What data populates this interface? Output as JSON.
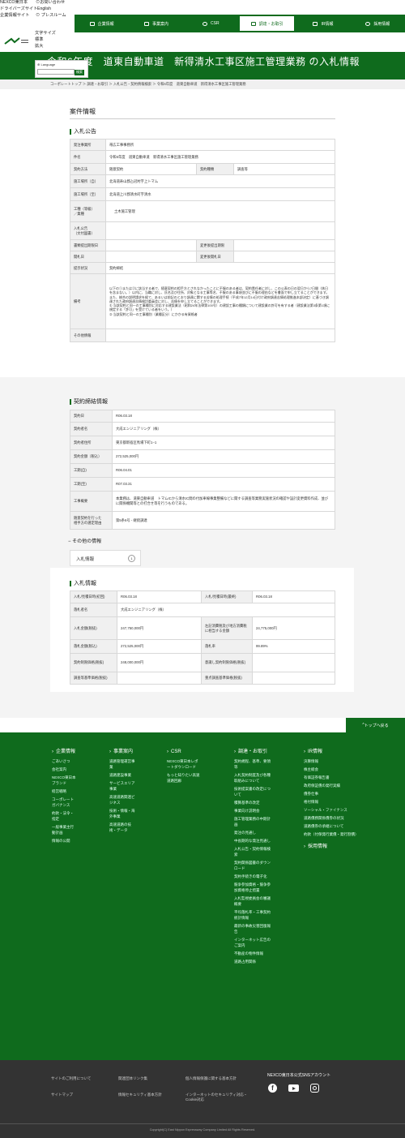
{
  "util": {
    "nexco": "NEXCO東日本",
    "contact": "お問い合わせ",
    "driver": "ドライバーズサイト",
    "english": "English",
    "company": "企業情報サイト",
    "press": "プレスルーム",
    "font": "文字サイズ",
    "standard": "標準",
    "large": "拡大"
  },
  "nav": [
    {
      "label": "企業情報"
    },
    {
      "label": "事業案内"
    },
    {
      "label": "CSR"
    },
    {
      "label": "調達・お取引"
    },
    {
      "label": "IR情報"
    },
    {
      "label": "採用情報"
    }
  ],
  "lang": {
    "label": "Language",
    "button": "検索"
  },
  "hero": {
    "title": "令和6年度　道東自動車道　新得清水工事区施工管理業務 の入札情報"
  },
  "breadcrumb": "コーポレートトップ ＞ 調達・お取引 ＞ 入札公告・契約情報検索 ＞ 令和6年度　道東自動車道　新得清水工事区施工管理業務",
  "case": {
    "title": "案件情報"
  },
  "bid": {
    "title": "入札公告",
    "rows": [
      {
        "h": "発注事業所",
        "v": "帯広工事事務所"
      },
      {
        "h": "件名",
        "v": "令和6年度　道東自動車道　新得清水工事区施工管理業務"
      },
      {
        "h": "施工場所（自）",
        "v": "北海道寿山郡占冠村字上トマム"
      },
      {
        "h": "施工場所（至）",
        "v": "北海道上川郡清水町字清水"
      },
      {
        "h": "工種（等級）\n／業種",
        "v": "土木施工管理"
      },
      {
        "h": "入札公告\n（文付図書）",
        "v": ""
      },
      {
        "h": "提示状況",
        "v": "契約締結"
      },
      {
        "h": "備考",
        "v": "以下の①または②に該当する者で、随意契約の相手方とされなかったことに不服のある者は、契約責任者に対し、この公表の日の翌日から7日間（休日を含まない。）以内に、当職に対し、氏名及び住所、対象となる工事等名、不服のある事項並びに不服の理由などを書面で申し立てることができます。また、総合の説明請求を経て、あるいは前記のとおり調達に関する苦情の処理手続（平成7年12月14日付け政府調達苦情処理推進本部決定）に基づき調達された政府調達苦情検討委員会に対し、苦情を申し立てることができます。\n① 当該契約と同一の工事種別に対応する建設業法（昭和24年法律第100号）の建設工事の種類について建設業の許可を有する者（建設業法第3条第1項に規定する「許可」を受けている者をいう。）\n② 当該契約と同一の工事種別（業種区分）にかかる有資格者"
      },
      {
        "h": "その他情報",
        "v": ""
      }
    ],
    "method_h": "契約方法",
    "method_v": "随意契約",
    "kind_h": "契約種類",
    "kind_v": "調査等",
    "deadline_h": "書類提出期限日",
    "change_deadline_h": "変更後提出期限",
    "open_h": "開札日",
    "change_open_h": "変更後開札日"
  },
  "contract": {
    "title": "契約締結情報",
    "rows": [
      {
        "h": "契約日",
        "v": "R06.03.18"
      },
      {
        "h": "契約者名",
        "v": "大成エンジニアリング（株）"
      },
      {
        "h": "契約者住所",
        "v": "東京都新宿区馬場下町1−1"
      },
      {
        "h": "契約金額（税込）",
        "v": "272,525,000円"
      },
      {
        "h": "工期(自)",
        "v": "R06.04.01"
      },
      {
        "h": "工期(至)",
        "v": "R07.03.31"
      },
      {
        "h": "工事概要",
        "v": "本業務は、道東自動車道　トマムICから清水IC間の付加車線事業整備などに関する調査等業務実施状況の確認や設計変更資料作成、並びに関係機関等との打合せ等を行うものである。"
      },
      {
        "h": "随意契約を行った\n相手方の選定理由",
        "v": "第5条6号 - 継続調達"
      }
    ]
  },
  "other": {
    "title": "その他の情報",
    "tab": "入札情報",
    "tabnum": "1"
  },
  "bidinfo": {
    "title": "入札情報",
    "rows": [
      [
        "入札/見積日時(初回)",
        "R06.03.18",
        "入札/見積日時(最終)",
        "R06.03.18"
      ],
      [
        "落札者名",
        "大成エンジニアリング（株）",
        "",
        ""
      ],
      [
        "入札金額(税抜)",
        "247,750,000円",
        "左記消費税及び地方消費税に相当する金額",
        "24,775,000円"
      ],
      [
        "落札金額(税込)",
        "272,525,000円",
        "落札率",
        "99.89%"
      ],
      [
        "契約制限価格(税抜)",
        "248,000,000円",
        "意識し契約制限価格(税抜)",
        ""
      ],
      [
        "調査等基準価格(税抜)",
        "",
        "重点調査基準価格(税抜)",
        ""
      ]
    ]
  },
  "totop": "トップへ戻る",
  "footer": {
    "cols": [
      {
        "title": "企業情報",
        "items": [
          "ごあいさつ",
          "会社案内",
          "NEXCO東日本ブランド",
          "経営戦略",
          "コーポレートガバナンス",
          "約款・法令・指定",
          "一般事業主行動計画",
          "情報の公開"
        ]
      },
      {
        "title": "事業案内",
        "items": [
          "道路管理運営事業",
          "道路建設事業",
          "サービスエリア事業",
          "高速道路関連ビジネス",
          "技術・情報・海外事業",
          "高速道路の技術・データ"
        ]
      },
      {
        "title": "CSR",
        "items": [
          "NEXCO東日本レポートダウンロード",
          "もっと知りたい高速道路回廊"
        ]
      },
      {
        "title": "調達・お取引",
        "items": [
          "契約規程、基準、要領等",
          "入札契約制度及び各種取組みについて",
          "技術提案書の改定について",
          "積算基準の改定",
          "事業向け説明会",
          "施工管理業務の中期計画",
          "発注の見通し",
          "中長期的な発注見通し",
          "入札公告・契約情報検索",
          "契約関係図書のダウンロード",
          "契約手続きの電子化",
          "競争参加資格・競争参加資格停止措置",
          "入札監視委員会の審議概要",
          "平均落札率・工事契約統計情報",
          "最新の事故災害回復報告",
          "インターネット広告のご案内",
          "不動産の物件情報",
          "道路占用関係"
        ]
      },
      {
        "title": "IR情報",
        "items": [
          "決算情報",
          "株主総会",
          "有価証券報告書",
          "政府保証債の発行実績",
          "債券仕事",
          "格付情報",
          "ソーシャル・ファイナンス",
          "道路債務関係債券の状況",
          "道路債券の承継について",
          "約款（付保発行業債・発行割債）"
        ]
      },
      {
        "title": "採用情報",
        "items": []
      }
    ],
    "links": [
      "サイトのご利用について",
      "関連団体リンク集",
      "個人情報保護に関する基本方針",
      "サイトマップ",
      "情報セキュリティ基本方針",
      "インターネットのセキュリティ対応・Cookie対応"
    ],
    "sns": "NEXCO東日本公式SNSアカウント",
    "copyright": "Copyright(C) East Nippon Expressway Company Limited All Rights Reserved."
  }
}
